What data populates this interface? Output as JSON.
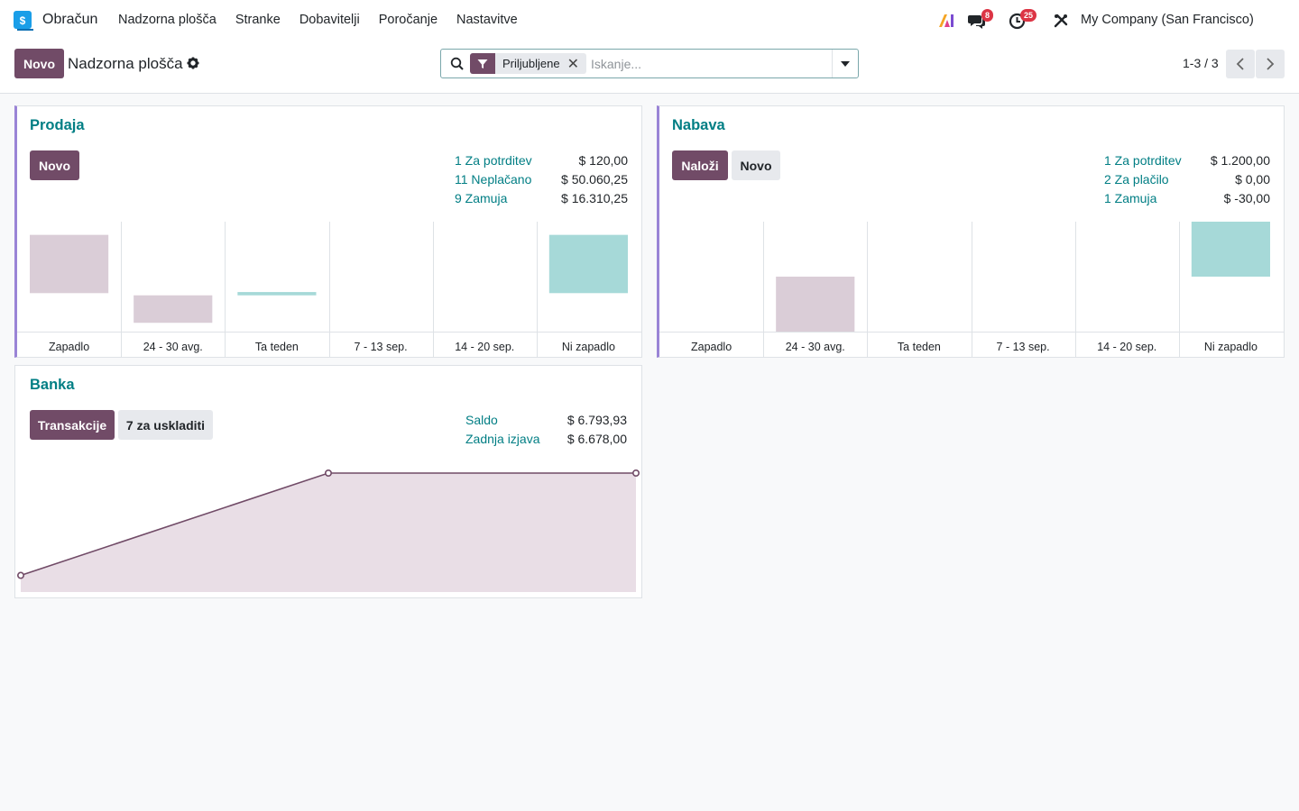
{
  "navbar": {
    "app_name": "Obračun",
    "menu": [
      "Nadzorna plošča",
      "Stranke",
      "Dobavitelji",
      "Poročanje",
      "Nastavitve"
    ],
    "messages_count": "8",
    "activities_count": "25",
    "company": "My Company (San Francisco)"
  },
  "control": {
    "new_label": "Novo",
    "title": "Nadzorna plošča",
    "facet_label": "Priljubljene",
    "search_placeholder": "Iskanje...",
    "pager": "1-3 / 3"
  },
  "colors": {
    "primary": "#714b67",
    "teal": "#017e84",
    "past_bar": "#dacdd7",
    "future_bar": "#a6d9d8",
    "accent_border": "#9a84d6"
  },
  "sales": {
    "title": "Prodaja",
    "new_label": "Novo",
    "stats": [
      {
        "label": "1 Za potrditev",
        "value": "$ 120,00"
      },
      {
        "label": "11 Neplačano",
        "value": "$ 50.060,25"
      },
      {
        "label": "9 Zamuja",
        "value": "$ 16.310,25"
      }
    ]
  },
  "purchase": {
    "title": "Nabava",
    "upload_label": "Naloži",
    "new_label": "Novo",
    "stats": [
      {
        "label": "1 Za potrditev",
        "value": "$ 1.200,00"
      },
      {
        "label": "2 Za plačilo",
        "value": "$ 0,00"
      },
      {
        "label": "1 Zamuja",
        "value": "$ -30,00"
      }
    ]
  },
  "bank": {
    "title": "Banka",
    "transactions_label": "Transakcije",
    "reconcile_label": "7 za uskladiti",
    "stats": [
      {
        "label": "Saldo",
        "value": "$ 6.793,93"
      },
      {
        "label": "Zadnja izjava",
        "value": "$ 6.678,00"
      }
    ]
  },
  "chart_data": [
    {
      "type": "bar",
      "categories": [
        "Zapadlo",
        "24 - 30 avg.",
        "Ta teden",
        "7 - 13 sep.",
        "14 - 20 sep.",
        "Ni zapadlo"
      ],
      "series": [
        {
          "values": [
            [
              0.35,
              0.88
            ],
            [
              0.08,
              0.33
            ],
            [
              0.33,
              0.36
            ],
            [
              0,
              0
            ],
            [
              0,
              0
            ],
            [
              0.35,
              0.88
            ]
          ]
        }
      ],
      "bar_kinds": [
        "past",
        "past",
        "future",
        "none",
        "none",
        "future"
      ]
    },
    {
      "type": "bar",
      "categories": [
        "Zapadlo",
        "24 - 30 avg.",
        "Ta teden",
        "7 - 13 sep.",
        "14 - 20 sep.",
        "Ni zapadlo"
      ],
      "series": [
        {
          "values": [
            [
              0,
              0
            ],
            [
              0,
              0.5
            ],
            [
              0,
              0
            ],
            [
              0,
              0
            ],
            [
              0,
              0
            ],
            [
              0.5,
              1.0
            ]
          ]
        }
      ],
      "bar_kinds": [
        "none",
        "past",
        "none",
        "none",
        "none",
        "future"
      ]
    },
    {
      "type": "area",
      "x": [
        0,
        1,
        2
      ],
      "series": [
        {
          "values": [
            0.14,
            1.0,
            1.0
          ]
        }
      ]
    }
  ]
}
